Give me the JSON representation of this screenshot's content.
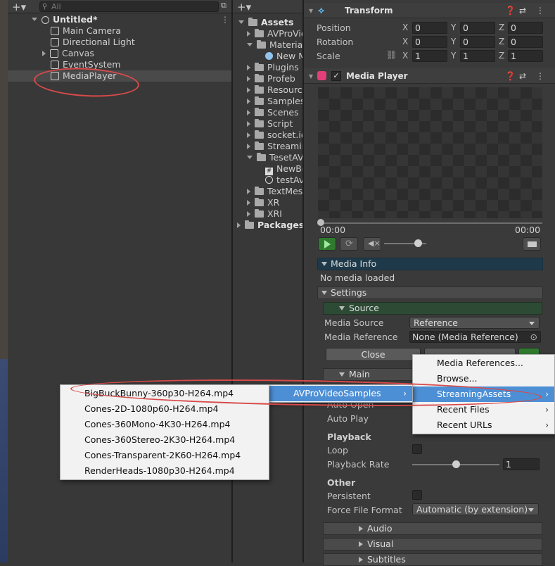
{
  "hierarchy": {
    "search_placeholder": "All",
    "scene_name": "Untitled*",
    "items": [
      {
        "label": "Main Camera"
      },
      {
        "label": "Directional Light"
      },
      {
        "label": "Canvas"
      },
      {
        "label": "EventSystem"
      },
      {
        "label": "MediaPlayer"
      }
    ]
  },
  "project": {
    "root": "Assets",
    "items": [
      "AVProVic",
      "Material",
      "New M",
      "Plugins",
      "Profeb",
      "Resource",
      "Samples",
      "Scenes",
      "Script",
      "socket.ic",
      "Streamin",
      "TesetAV",
      "NewBe",
      "testAv",
      "TextMes",
      "XR",
      "XRI"
    ],
    "packages": "Packages"
  },
  "inspector": {
    "transform": {
      "title": "Transform",
      "position": {
        "label": "Position",
        "x": "0",
        "y": "0",
        "z": "0"
      },
      "rotation": {
        "label": "Rotation",
        "x": "0",
        "y": "0",
        "z": "0"
      },
      "scale": {
        "label": "Scale",
        "x": "1",
        "y": "1",
        "z": "1"
      },
      "axis_x": "X",
      "axis_y": "Y",
      "axis_z": "Z"
    },
    "media_player": {
      "title": "Media Player",
      "time_start": "00:00",
      "time_end": "00:00",
      "volume": 0.8,
      "media_info": {
        "header": "Media Info",
        "status": "No media loaded"
      },
      "settings": {
        "header": "Settings",
        "source": {
          "header": "Source",
          "media_source_label": "Media Source",
          "media_source_value": "Reference",
          "media_reference_label": "Media Reference",
          "media_reference_value": "None (Media Reference)",
          "close_button": "Close"
        },
        "main": {
          "header": "Main",
          "auto_open": "Auto Open",
          "auto_play": "Auto Play"
        },
        "playback": {
          "header": "Playback",
          "loop": "Loop",
          "rate_label": "Playback Rate",
          "rate_value": "1",
          "rate_slider": 0.5
        },
        "other": {
          "header": "Other",
          "persistent": "Persistent",
          "force_format_label": "Force File Format",
          "force_format_value": "Automatic (by extension)"
        }
      },
      "collapsed_sections": [
        "Audio",
        "Visual",
        "Subtitles"
      ]
    }
  },
  "context_menu": {
    "level1": [
      {
        "label": "Media References...",
        "submenu": false
      },
      {
        "label": "Browse...",
        "submenu": false
      },
      {
        "label": "StreamingAssets",
        "submenu": true
      },
      {
        "label": "Recent Files",
        "submenu": true
      },
      {
        "label": "Recent URLs",
        "submenu": true
      }
    ],
    "level2": [
      {
        "label": "AVProVideoSamples",
        "submenu": true
      }
    ],
    "level3": [
      {
        "label": "BigBuckBunny-360p30-H264.mp4"
      },
      {
        "label": "Cones-2D-1080p60-H264.mp4"
      },
      {
        "label": "Cones-360Mono-4K30-H264.mp4"
      },
      {
        "label": "Cones-360Stereo-2K30-H264.mp4"
      },
      {
        "label": "Cones-Transparent-2K60-H264.mp4"
      },
      {
        "label": "RenderHeads-1080p30-H264.mp4"
      }
    ]
  },
  "colors": {
    "highlight": "#4d8fd5",
    "annotation": "#d94a4a",
    "media_info_header": "#1e3a4a",
    "source_header": "#2c4a34"
  }
}
